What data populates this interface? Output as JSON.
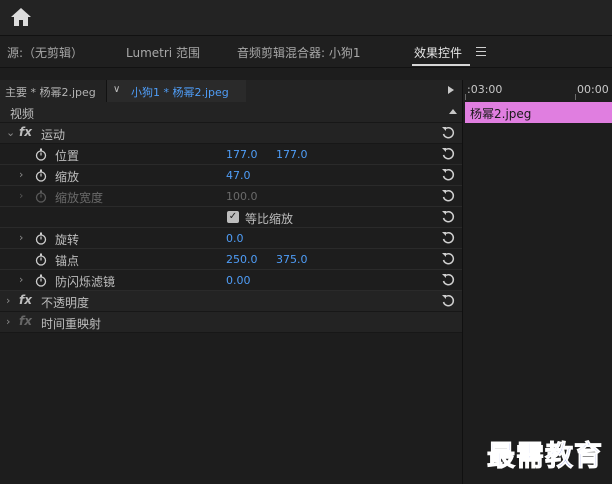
{
  "tabs": [
    {
      "label": "源:（无剪辑）"
    },
    {
      "label": "Lumetri 范围"
    },
    {
      "label": "音频剪辑混合器: 小狗1"
    },
    {
      "label": "效果控件"
    }
  ],
  "clipbar": {
    "master_label": "主要 * 杨幂2.jpeg",
    "sequence_label": "小狗1 * 杨幂2.jpeg"
  },
  "timeline": {
    "time_left": ":03:00",
    "time_right": "00:00",
    "clip_name": "杨幂2.jpeg",
    "clip_color": "#e07ee0"
  },
  "section": {
    "label": "视频"
  },
  "effects": {
    "motion": {
      "label": "运动"
    },
    "position": {
      "label": "位置",
      "x": "177.0",
      "y": "177.0"
    },
    "scale": {
      "label": "缩放",
      "value": "47.0"
    },
    "scale_width": {
      "label": "缩放宽度",
      "value": "100.0"
    },
    "uniform_scale": {
      "label": "等比缩放",
      "checked": true
    },
    "rotation": {
      "label": "旋转",
      "value": "0.0"
    },
    "anchor": {
      "label": "锚点",
      "x": "250.0",
      "y": "375.0"
    },
    "anti_flicker": {
      "label": "防闪烁滤镜",
      "value": "0.00"
    },
    "opacity": {
      "label": "不透明度"
    },
    "time_remap": {
      "label": "时间重映射"
    }
  },
  "watermark": "最需教育",
  "colors": {
    "accent": "#4f9df7",
    "background": "#1d1d1d"
  }
}
